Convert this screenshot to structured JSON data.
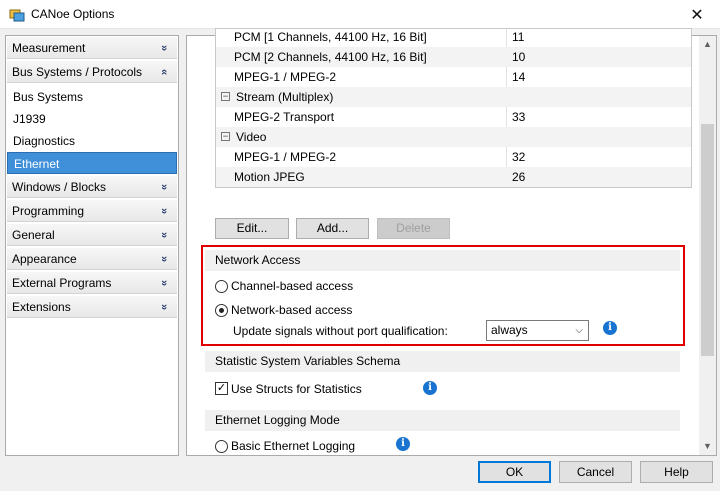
{
  "window": {
    "title": "CANoe Options",
    "close_glyph": "✕"
  },
  "sidebar": {
    "items": [
      {
        "label": "Measurement",
        "type": "group",
        "icon": "chevron-down-double-icon",
        "glyph": "»"
      },
      {
        "label": "Bus Systems / Protocols",
        "type": "group",
        "icon": "chevron-up-double-icon",
        "glyph": "«"
      },
      {
        "label": "Bus Systems",
        "type": "sub"
      },
      {
        "label": "J1939",
        "type": "sub"
      },
      {
        "label": "Diagnostics",
        "type": "sub"
      },
      {
        "label": "Ethernet",
        "type": "sub",
        "selected": true
      },
      {
        "label": "Windows / Blocks",
        "type": "group",
        "icon": "chevron-down-double-icon",
        "glyph": "»"
      },
      {
        "label": "Programming",
        "type": "group",
        "icon": "chevron-down-double-icon",
        "glyph": "»"
      },
      {
        "label": "General",
        "type": "group",
        "icon": "chevron-down-double-icon",
        "glyph": "»"
      },
      {
        "label": "Appearance",
        "type": "group",
        "icon": "chevron-down-double-icon",
        "glyph": "»"
      },
      {
        "label": "External Programs",
        "type": "group",
        "icon": "chevron-down-double-icon",
        "glyph": "»"
      },
      {
        "label": "Extensions",
        "type": "group",
        "icon": "chevron-down-double-icon",
        "glyph": "»"
      }
    ]
  },
  "table": {
    "rows": [
      {
        "name": "PCM [1 Channels, 44100 Hz, 16 Bit]",
        "value": "11",
        "kind": "item"
      },
      {
        "name": "PCM [2 Channels, 44100 Hz, 16 Bit]",
        "value": "10",
        "kind": "item"
      },
      {
        "name": "MPEG-1 / MPEG-2",
        "value": "14",
        "kind": "item"
      },
      {
        "name": "Stream (Multiplex)",
        "value": "",
        "kind": "category"
      },
      {
        "name": "MPEG-2 Transport",
        "value": "33",
        "kind": "item"
      },
      {
        "name": "Video",
        "value": "",
        "kind": "category"
      },
      {
        "name": "MPEG-1 / MPEG-2",
        "value": "32",
        "kind": "item"
      },
      {
        "name": "Motion JPEG",
        "value": "26",
        "kind": "item"
      }
    ],
    "collapse_glyph": "−"
  },
  "table_buttons": {
    "edit": "Edit...",
    "add": "Add...",
    "delete": "Delete"
  },
  "network_access": {
    "header": "Network Access",
    "option_channel": "Channel-based access",
    "option_network": "Network-based access",
    "selected": "network",
    "update_label": "Update signals without port qualification:",
    "update_value": "always"
  },
  "statistic": {
    "header": "Statistic System Variables Schema",
    "use_structs_label": "Use Structs for Statistics",
    "use_structs_checked": true
  },
  "logging": {
    "header": "Ethernet Logging Mode",
    "basic_label": "Basic Ethernet Logging"
  },
  "info_glyph": "i",
  "footer": {
    "ok": "OK",
    "cancel": "Cancel",
    "help": "Help"
  },
  "colors": {
    "selection": "#3f8fd9",
    "highlight": "#e00000",
    "info": "#1874d0",
    "primary_border": "#0078d7"
  }
}
